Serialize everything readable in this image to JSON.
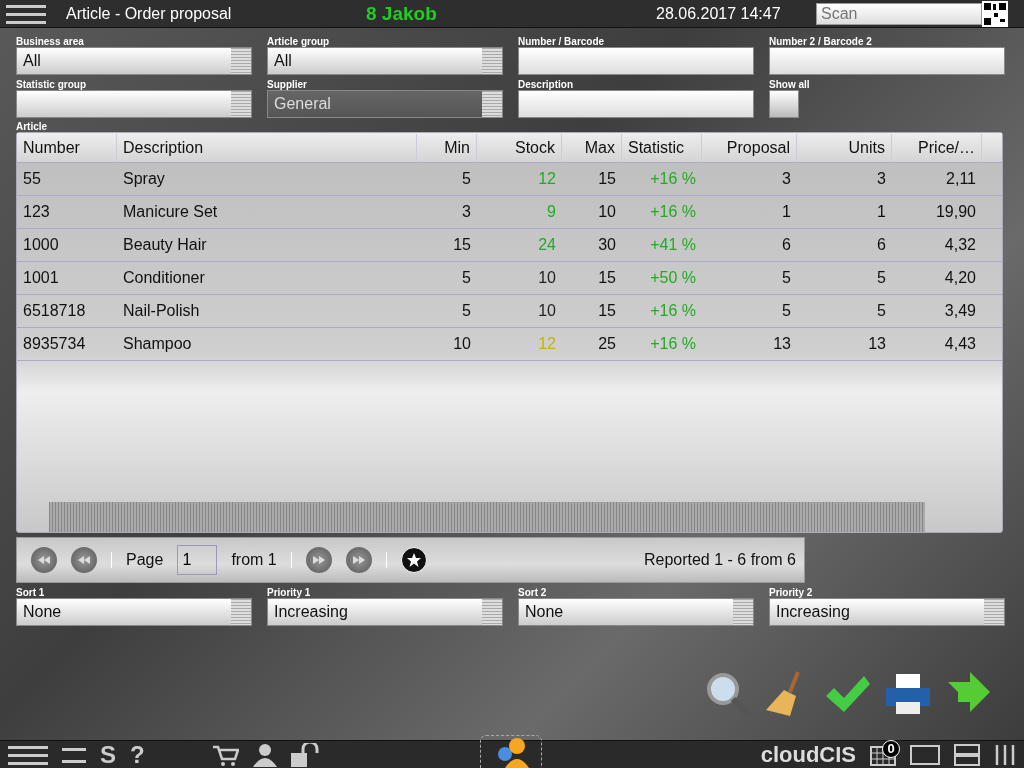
{
  "header": {
    "title": "Article - Order proposal",
    "user": "8 Jakob",
    "datetime": "28.06.2017 14:47",
    "scan_placeholder": "Scan"
  },
  "filters": [
    {
      "label": "Business area",
      "value": "All",
      "kind": "select",
      "disabled": false
    },
    {
      "label": "Article group",
      "value": "All",
      "kind": "select",
      "disabled": false
    },
    {
      "label": "Number / Barcode",
      "kind": "text",
      "disabled": false
    },
    {
      "label": "Number 2 / Barcode 2",
      "kind": "text",
      "disabled": false
    },
    {
      "label": "Statistic group",
      "kind": "select",
      "disabled": false
    },
    {
      "label": "Supplier",
      "value": "General",
      "kind": "select",
      "disabled": true
    },
    {
      "label": "Description",
      "kind": "text",
      "disabled": false
    },
    {
      "label": "Show all",
      "kind": "checkbox",
      "checked": false
    }
  ],
  "table": {
    "label": "Article",
    "columns": [
      "Number",
      "Description",
      "Min",
      "Stock",
      "Max",
      "Statistic",
      "Proposal",
      "Units",
      "Price/…"
    ],
    "rows": [
      {
        "number": "55",
        "description": "Spray",
        "min": "5",
        "stock": {
          "value": "12",
          "color": "#22aa22"
        },
        "max": "15",
        "statistic": "+16 %",
        "proposal": "3",
        "units": "3",
        "price": "2,11"
      },
      {
        "number": "123",
        "description": "Manicure Set",
        "min": "3",
        "stock": {
          "value": "9",
          "color": "#22aa22"
        },
        "max": "10",
        "statistic": "+16 %",
        "proposal": "1",
        "units": "1",
        "price": "19,90"
      },
      {
        "number": "1000",
        "description": "Beauty Hair",
        "min": "15",
        "stock": {
          "value": "24",
          "color": "#22aa22"
        },
        "max": "30",
        "statistic": "+41 %",
        "proposal": "6",
        "units": "6",
        "price": "4,32"
      },
      {
        "number": "1001",
        "description": "Conditioner",
        "min": "5",
        "stock": {
          "value": "10",
          "color": "#222222"
        },
        "max": "15",
        "statistic": "+50 %",
        "proposal": "5",
        "units": "5",
        "price": "4,20"
      },
      {
        "number": "6518718",
        "description": "Nail-Polish",
        "min": "5",
        "stock": {
          "value": "10",
          "color": "#222222"
        },
        "max": "15",
        "statistic": "+16 %",
        "proposal": "5",
        "units": "5",
        "price": "3,49"
      },
      {
        "number": "8935734",
        "description": "Shampoo",
        "min": "10",
        "stock": {
          "value": "12",
          "color": "#c8b400"
        },
        "max": "25",
        "statistic": "+16 %",
        "proposal": "13",
        "units": "13",
        "price": "4,43"
      }
    ]
  },
  "pager": {
    "page_label": "Page",
    "page": "1",
    "from": "from 1",
    "reported": "Reported 1 - 6 from 6"
  },
  "sorting": [
    {
      "label": "Sort 1",
      "value": "None"
    },
    {
      "label": "Priority 1",
      "value": "Increasing"
    },
    {
      "label": "Sort 2",
      "value": "None"
    },
    {
      "label": "Priority 2",
      "value": "Increasing"
    }
  ],
  "bottom_bar": {
    "s_key": "S",
    "help_key": "?",
    "brand": "cloudCIS",
    "calendar_count": "0"
  }
}
